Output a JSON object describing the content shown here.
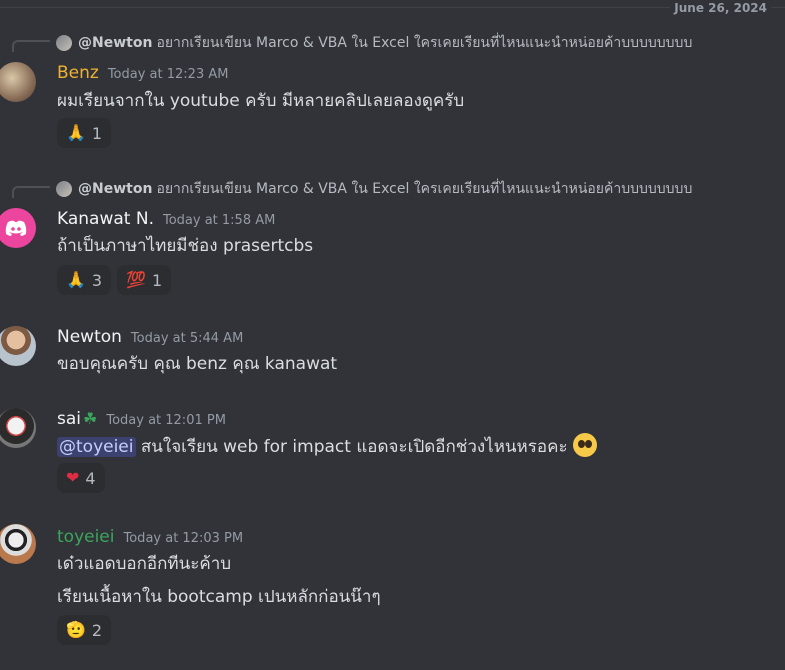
{
  "date_divider": "June 26, 2024",
  "messages": [
    {
      "reply": {
        "name": "@Newton",
        "text": "อยากเรียนเขียน Marco & VBA ใน Excel ใครเคยเรียนที่ไหนแนะนำหน่อยค้าบบบบบบบบ"
      },
      "username": "Benz",
      "timestamp": "Today at 12:23 AM",
      "lines": [
        "ผมเรียนจากใน youtube ครับ มีหลายคลิปเลยลองดูครับ"
      ],
      "reactions": [
        {
          "icon": "🙏",
          "icon_name": "folded-hands-icon",
          "count": "1"
        }
      ]
    },
    {
      "reply": {
        "name": "@Newton",
        "text": "อยากเรียนเขียน Marco & VBA ใน Excel ใครเคยเรียนที่ไหนแนะนำหน่อยค้าบบบบบบบบ"
      },
      "username": "Kanawat N.",
      "timestamp": "Today at 1:58 AM",
      "lines": [
        "ถ้าเป็นภาษาไทยมีช่อง prasertcbs"
      ],
      "reactions": [
        {
          "icon": "🙏",
          "icon_name": "folded-hands-icon",
          "count": "3"
        },
        {
          "icon": "💯",
          "icon_name": "hundred-points-icon",
          "count": "1"
        }
      ]
    },
    {
      "username": "Newton",
      "timestamp": "Today at 5:44 AM",
      "lines": [
        "ขอบคุณครับ คุณ benz คุณ kanawat"
      ]
    },
    {
      "username": "sai",
      "username_suffix": "☘",
      "timestamp": "Today at 12:01 PM",
      "mention": "@toyeiei",
      "lines": [
        " สนใจเรียน web for impact แอดจะเปิดอีกช่วงไหนหรอคะ"
      ],
      "reactions": [
        {
          "icon": "❤",
          "icon_name": "heart-icon",
          "count": "4"
        }
      ]
    },
    {
      "username": "toyeiei",
      "timestamp": "Today at 12:03 PM",
      "lines": [
        "เด๋วแอดบอกอีกทีนะค้าบ",
        "เรียนเนื้อหาใน bootcamp เปนหลักก่อนน๊าๆ"
      ],
      "reactions": [
        {
          "icon": "🫡",
          "icon_name": "saluting-face-icon",
          "count": "2"
        }
      ]
    }
  ],
  "colors": {
    "background": "#313338",
    "benz_name": "#f0b232",
    "toyeiei_name": "#3ba55c",
    "mention_bg": "#3c4270",
    "discord_avatar": "#eb459e"
  }
}
